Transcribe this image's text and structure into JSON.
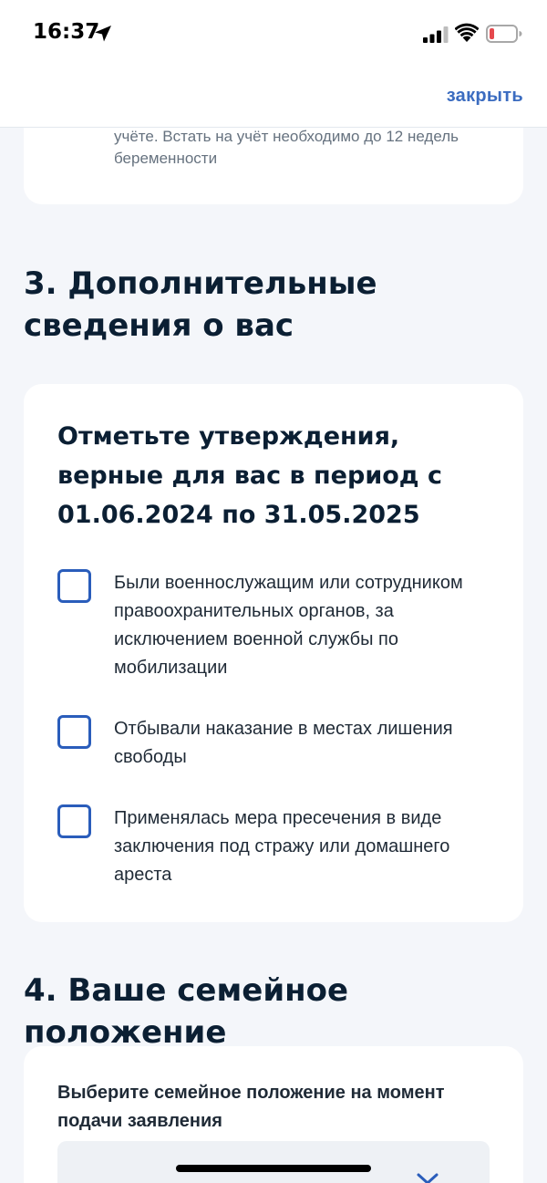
{
  "status_bar": {
    "time": "16:37"
  },
  "nav": {
    "close_label": "закрыть"
  },
  "top_card": {
    "text": "учёте. Встать на учёт необходимо до 12 недель беременности"
  },
  "section3": {
    "title": "3. Дополнительные сведения о вас",
    "card_heading": "Отметьте утверждения, верные для вас в период с 01.06.2024 по 31.05.2025",
    "options": [
      {
        "label": "Были военнослужащим или сотрудником правоохранительных органов, за исключением военной службы по мобилизации",
        "checked": false
      },
      {
        "label": "Отбывали наказание в местах лишения свободы",
        "checked": false
      },
      {
        "label": "Применялась мера пресечения в виде заключения под стражу или домашнего ареста",
        "checked": false
      }
    ]
  },
  "section4": {
    "title": "4. Ваше семейное положение",
    "field_label": "Выберите семейное положение на момент подачи заявления"
  },
  "colors": {
    "accent": "#2a5dbb",
    "link": "#3b6cc0",
    "background": "#f4f6fa",
    "card": "#ffffff",
    "battery_low": "#e5484d"
  },
  "icons": {
    "location": "location-arrow-icon",
    "signal": "cellular-signal-icon",
    "wifi": "wifi-icon",
    "battery": "battery-low-icon",
    "select_chevron": "chevron-down-icon"
  }
}
